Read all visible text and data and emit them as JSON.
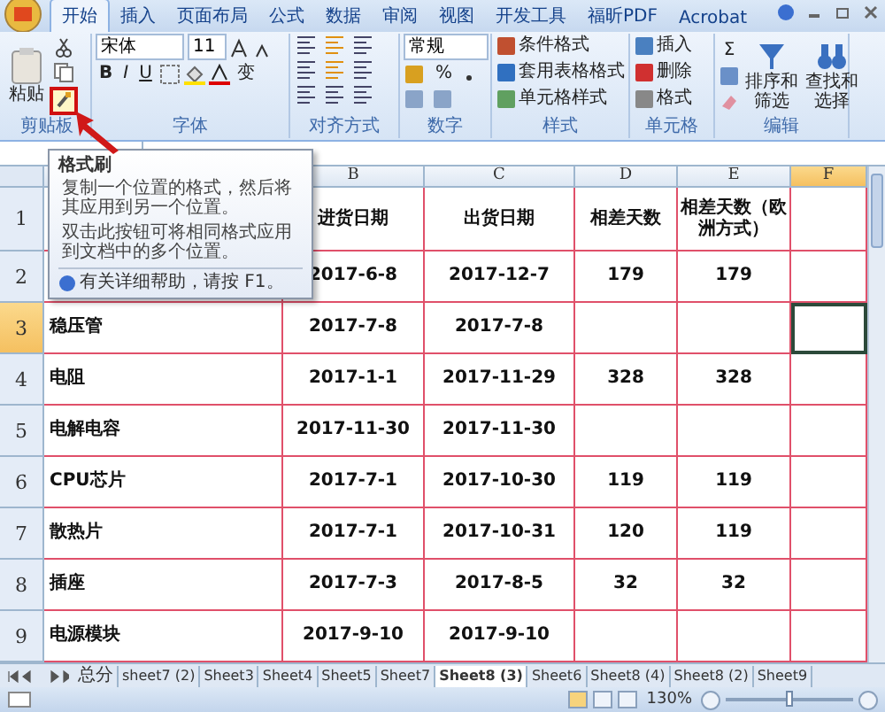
{
  "ribbon_tabs": [
    {
      "label": "开始",
      "selected": true
    },
    {
      "label": "插入",
      "selected": false
    },
    {
      "label": "页面布局",
      "selected": false
    },
    {
      "label": "公式",
      "selected": false
    },
    {
      "label": "数据",
      "selected": false
    },
    {
      "label": "审阅",
      "selected": false
    },
    {
      "label": "视图",
      "selected": false
    },
    {
      "label": "开发工具",
      "selected": false
    },
    {
      "label": "福昕PDF",
      "selected": false
    },
    {
      "label": "Acrobat",
      "selected": false
    }
  ],
  "ribbon": {
    "clipboard": {
      "label": "剪贴板",
      "paste": "粘贴",
      "format_painter_highlighted": true
    },
    "font": {
      "label": "字体",
      "font_name": "宋体",
      "font_size": "11",
      "bold": "B",
      "italic": "I",
      "underline": "U",
      "phonetic": "变"
    },
    "alignment": {
      "label": "对齐方式"
    },
    "number": {
      "label": "数字",
      "format": "常规",
      "percent": "%"
    },
    "styles": {
      "label": "样式",
      "items": [
        "条件格式",
        "套用表格格式",
        "单元格样式"
      ]
    },
    "cells": {
      "label": "单元格",
      "items": [
        "插入",
        "删除",
        "格式"
      ]
    },
    "editing": {
      "label": "编辑",
      "sum": "Σ",
      "items": [
        "排序和筛选",
        "查找和选择"
      ]
    }
  },
  "tooltip": {
    "title": "格式刷",
    "paragraphs": [
      "复制一个位置的格式，然后将其应用到另一个位置。",
      "双击此按钮可将相同格式应用到文档中的多个位置。"
    ],
    "help": "有关详细帮助，请按 F1。"
  },
  "sheet": {
    "columns": [
      {
        "selected": false
      },
      {
        "label": "B",
        "selected": false
      },
      {
        "label": "C",
        "selected": false
      },
      {
        "label": "D",
        "selected": false
      },
      {
        "label": "E",
        "selected": false
      },
      {
        "label": "F",
        "selected": true
      }
    ],
    "rows": [
      {
        "number": "1",
        "selected": false,
        "cells": [
          null,
          "进货日期",
          "出货日期",
          "相差天数",
          "相差天数（欧洲方式）",
          null
        ]
      },
      {
        "number": "2",
        "selected": false,
        "cells": [
          null,
          "2017-6-8",
          "2017-12-7",
          "179",
          "179",
          null
        ]
      },
      {
        "number": "3",
        "selected": true,
        "cells": [
          "稳压管",
          "2017-7-8",
          "2017-7-8",
          null,
          null,
          null
        ]
      },
      {
        "number": "4",
        "selected": false,
        "cells": [
          "电阻",
          "2017-1-1",
          "2017-11-29",
          "328",
          "328",
          null
        ]
      },
      {
        "number": "5",
        "selected": false,
        "cells": [
          "电解电容",
          "2017-11-30",
          "2017-11-30",
          null,
          null,
          null
        ]
      },
      {
        "number": "6",
        "selected": false,
        "cells": [
          "CPU芯片",
          "2017-7-1",
          "2017-10-30",
          "119",
          "119",
          null
        ]
      },
      {
        "number": "7",
        "selected": false,
        "cells": [
          "散热片",
          "2017-7-1",
          "2017-10-31",
          "120",
          "119",
          null
        ]
      },
      {
        "number": "8",
        "selected": false,
        "cells": [
          "插座",
          "2017-7-3",
          "2017-8-5",
          "32",
          "32",
          null
        ]
      },
      {
        "number": "9",
        "selected": false,
        "cells": [
          "电源模块",
          "2017-9-10",
          "2017-9-10",
          null,
          null,
          null
        ]
      }
    ]
  },
  "sheet_tabs": [
    {
      "label": "总分",
      "selected": false
    },
    {
      "label": "sheet7 (2)",
      "selected": false
    },
    {
      "label": "Sheet3",
      "selected": false
    },
    {
      "label": "Sheet4",
      "selected": false
    },
    {
      "label": "Sheet5",
      "selected": false
    },
    {
      "label": "Sheet7",
      "selected": false
    },
    {
      "label": "Sheet8 (3)",
      "selected": true
    },
    {
      "label": "Sheet6",
      "selected": false
    },
    {
      "label": "Sheet8 (4)",
      "selected": false
    },
    {
      "label": "Sheet8 (2)",
      "selected": false
    },
    {
      "label": "Sheet9",
      "selected": false
    }
  ],
  "status_bar": {
    "views": [
      {
        "selected": true
      },
      {
        "selected": false
      },
      {
        "selected": false
      }
    ],
    "zoom": "130%",
    "zoom_slider": {
      "level": 0.5
    }
  }
}
